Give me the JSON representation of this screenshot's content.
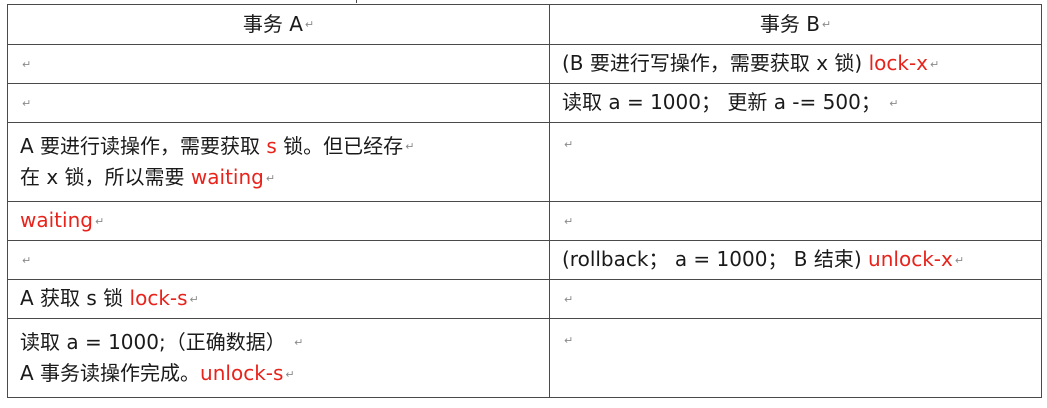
{
  "headers": {
    "a": "事务 A",
    "b": "事务 B"
  },
  "mark": "↵",
  "rows": [
    {
      "a": [],
      "b": [
        {
          "plain": "(B 要进行写操作，需要获取 x 锁) ",
          "red": "lock-x"
        }
      ]
    },
    {
      "a": [],
      "b": [
        {
          "plain": "读取 a = 1000；  更新  a -= 500；  ",
          "red": ""
        }
      ]
    },
    {
      "a": [
        {
          "plain": "A 要进行读操作，需要获取 ",
          "red": "s",
          "after": " 锁。但已经存"
        },
        {
          "plain": "在 x 锁，所以需要 ",
          "red": "waiting",
          "after": ""
        }
      ],
      "b": []
    },
    {
      "a": [
        {
          "plain": "",
          "red": "waiting",
          "after": ""
        }
      ],
      "b": []
    },
    {
      "a": [],
      "b": [
        {
          "plain": "(rollback；  a = 1000；  B 结束) ",
          "red": "unlock-x"
        }
      ]
    },
    {
      "a": [
        {
          "plain": "A 获取 s 锁  ",
          "red": "lock-s",
          "after": ""
        }
      ],
      "b": []
    },
    {
      "a": [
        {
          "plain": "读取 a = 1000;（正确数据）  ",
          "red": "",
          "after": ""
        },
        {
          "plain": "A 事务读操作完成。",
          "red": "unlock-s",
          "after": ""
        }
      ],
      "b": []
    }
  ]
}
